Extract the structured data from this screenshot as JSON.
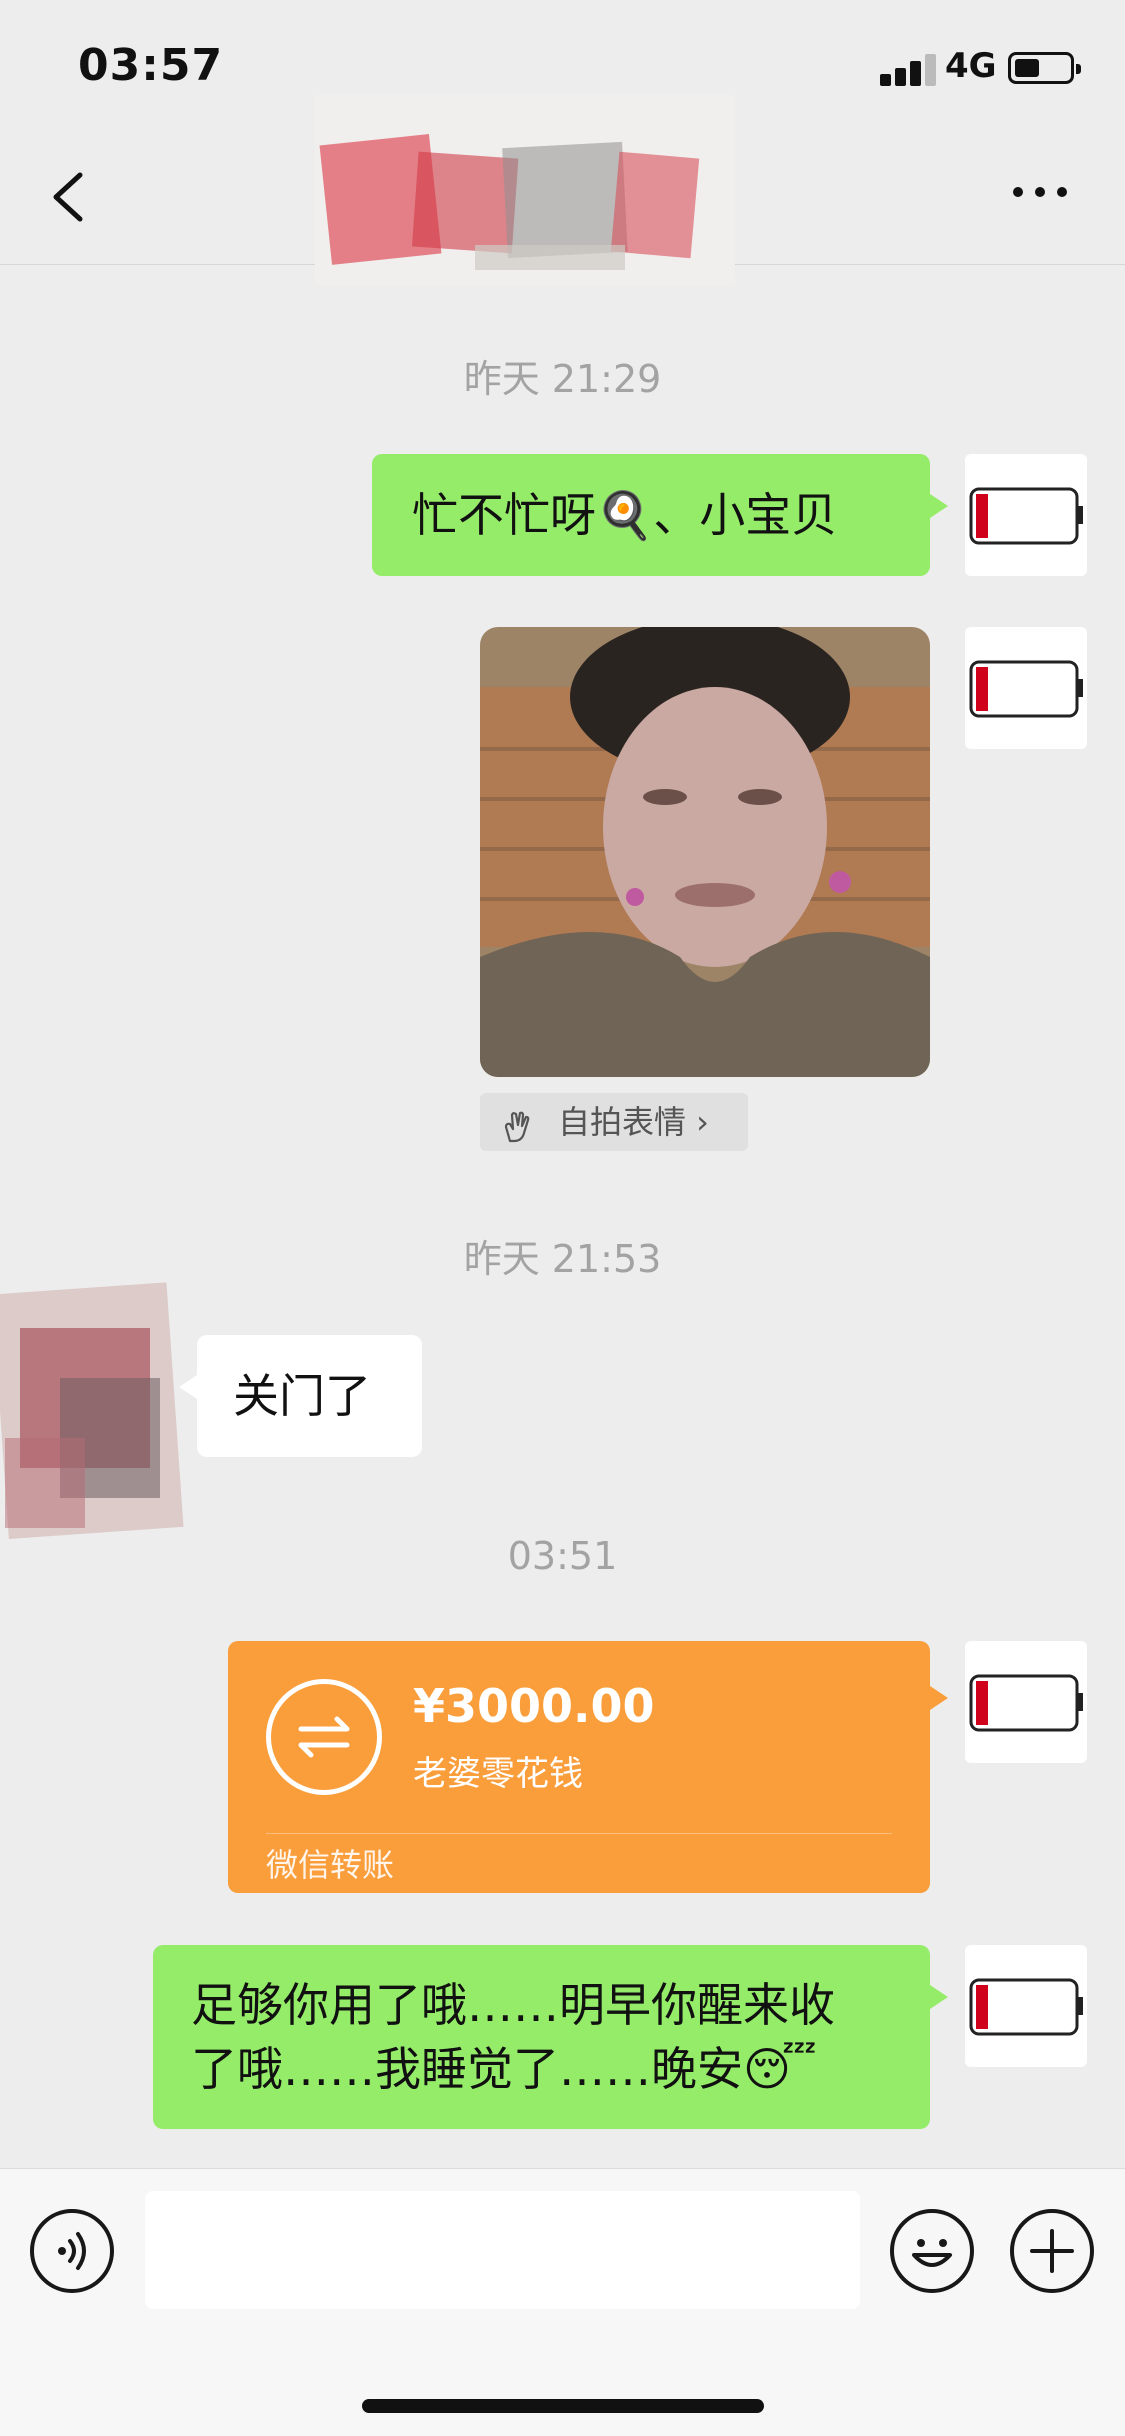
{
  "status_bar": {
    "time": "03:57",
    "network": "4G",
    "battery_icon": "battery-icon",
    "signal_icon": "signal-icon"
  },
  "nav": {
    "back_icon": "chevron-left-icon",
    "more_icon": "more-dots-icon",
    "contact_name_obscured": true
  },
  "messages": {
    "ts1": "昨天 21:29",
    "msg1": "忙不忙呀🍳、小宝贝",
    "selfie_tag": "自拍表情 ›",
    "ts2": "昨天 21:53",
    "msg2": "关门了",
    "ts3": "03:51",
    "transfer": {
      "amount": "¥3000.00",
      "note": "老婆零花钱",
      "brand": "微信转账"
    },
    "msg3_line1": "足够你用了哦……明早你醒来收",
    "msg3_line2": "了哦……我睡觉了……晚安😴"
  },
  "input_bar": {
    "voice_icon": "voice-icon",
    "emoji_icon": "emoji-icon",
    "plus_icon": "plus-icon"
  },
  "colors": {
    "green_bubble": "#95ec69",
    "transfer_orange": "#fa9d3b",
    "background": "#ededed"
  }
}
